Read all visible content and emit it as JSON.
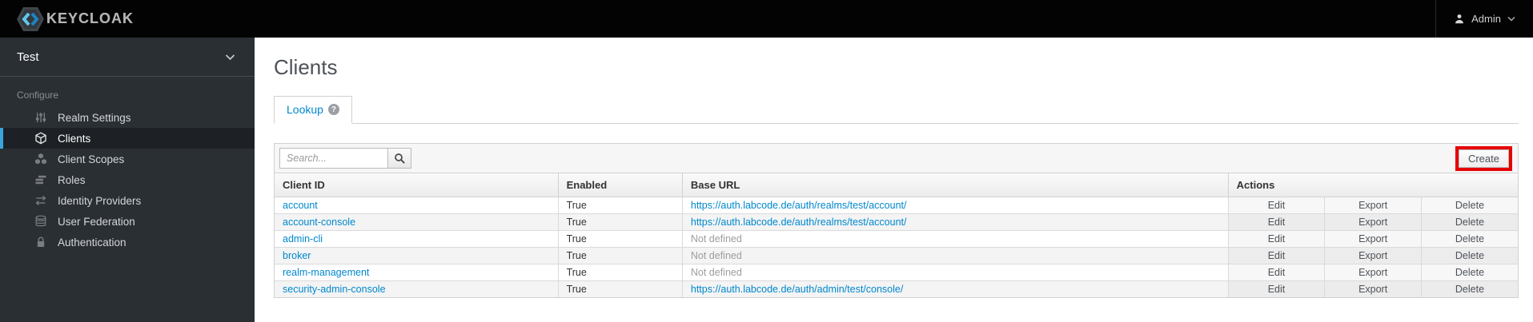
{
  "topbar": {
    "logo_text": "KEYCLOAK",
    "user": "Admin",
    "icons": [
      "keycloak-logo-icon",
      "user-icon",
      "chevron-down-icon"
    ]
  },
  "sidebar": {
    "realm": "Test",
    "realm_chevron_icon": "chevron-down-icon",
    "section_label": "Configure",
    "items": [
      {
        "label": "Realm Settings",
        "icon": "sliders-icon",
        "active": false
      },
      {
        "label": "Clients",
        "icon": "cube-icon",
        "active": true
      },
      {
        "label": "Client Scopes",
        "icon": "cubes-icon",
        "active": false
      },
      {
        "label": "Roles",
        "icon": "list-icon",
        "active": false
      },
      {
        "label": "Identity Providers",
        "icon": "exchange-icon",
        "active": false
      },
      {
        "label": "User Federation",
        "icon": "database-icon",
        "active": false
      },
      {
        "label": "Authentication",
        "icon": "lock-icon",
        "active": false
      }
    ]
  },
  "main": {
    "title": "Clients",
    "tab": "Lookup",
    "help_icon": "help-icon",
    "help_glyph": "?",
    "search_placeholder": "Search...",
    "search_icon": "search-icon",
    "create_label": "Create",
    "table": {
      "headers": [
        "Client ID",
        "Enabled",
        "Base URL",
        "Actions"
      ],
      "actions": [
        "Edit",
        "Export",
        "Delete"
      ],
      "rows": [
        {
          "client_id": "account",
          "enabled": "True",
          "base_url": "https://auth.labcode.de/auth/realms/test/account/",
          "url_defined": true
        },
        {
          "client_id": "account-console",
          "enabled": "True",
          "base_url": "https://auth.labcode.de/auth/realms/test/account/",
          "url_defined": true
        },
        {
          "client_id": "admin-cli",
          "enabled": "True",
          "base_url": "Not defined",
          "url_defined": false
        },
        {
          "client_id": "broker",
          "enabled": "True",
          "base_url": "Not defined",
          "url_defined": false
        },
        {
          "client_id": "realm-management",
          "enabled": "True",
          "base_url": "Not defined",
          "url_defined": false
        },
        {
          "client_id": "security-admin-console",
          "enabled": "True",
          "base_url": "https://auth.labcode.de/auth/admin/test/console/",
          "url_defined": true
        }
      ]
    }
  },
  "colors": {
    "link": "#0088ce",
    "active_indicator": "#39a5dc",
    "create_highlight": "#e60000",
    "sidebar_bg": "#2a2f34",
    "topbar_bg": "#030303"
  }
}
